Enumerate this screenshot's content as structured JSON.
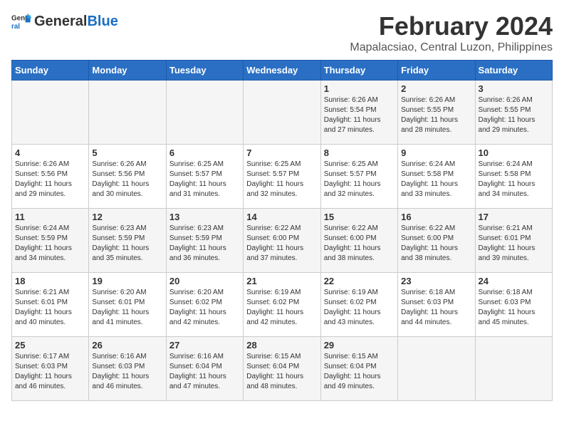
{
  "header": {
    "logo_general": "General",
    "logo_blue": "Blue",
    "title": "February 2024",
    "subtitle": "Mapalacsiao, Central Luzon, Philippines"
  },
  "days_of_week": [
    "Sunday",
    "Monday",
    "Tuesday",
    "Wednesday",
    "Thursday",
    "Friday",
    "Saturday"
  ],
  "weeks": [
    [
      {
        "day": "",
        "content": ""
      },
      {
        "day": "",
        "content": ""
      },
      {
        "day": "",
        "content": ""
      },
      {
        "day": "",
        "content": ""
      },
      {
        "day": "1",
        "content": "Sunrise: 6:26 AM\nSunset: 5:54 PM\nDaylight: 11 hours\nand 27 minutes."
      },
      {
        "day": "2",
        "content": "Sunrise: 6:26 AM\nSunset: 5:55 PM\nDaylight: 11 hours\nand 28 minutes."
      },
      {
        "day": "3",
        "content": "Sunrise: 6:26 AM\nSunset: 5:55 PM\nDaylight: 11 hours\nand 29 minutes."
      }
    ],
    [
      {
        "day": "4",
        "content": "Sunrise: 6:26 AM\nSunset: 5:56 PM\nDaylight: 11 hours\nand 29 minutes."
      },
      {
        "day": "5",
        "content": "Sunrise: 6:26 AM\nSunset: 5:56 PM\nDaylight: 11 hours\nand 30 minutes."
      },
      {
        "day": "6",
        "content": "Sunrise: 6:25 AM\nSunset: 5:57 PM\nDaylight: 11 hours\nand 31 minutes."
      },
      {
        "day": "7",
        "content": "Sunrise: 6:25 AM\nSunset: 5:57 PM\nDaylight: 11 hours\nand 32 minutes."
      },
      {
        "day": "8",
        "content": "Sunrise: 6:25 AM\nSunset: 5:57 PM\nDaylight: 11 hours\nand 32 minutes."
      },
      {
        "day": "9",
        "content": "Sunrise: 6:24 AM\nSunset: 5:58 PM\nDaylight: 11 hours\nand 33 minutes."
      },
      {
        "day": "10",
        "content": "Sunrise: 6:24 AM\nSunset: 5:58 PM\nDaylight: 11 hours\nand 34 minutes."
      }
    ],
    [
      {
        "day": "11",
        "content": "Sunrise: 6:24 AM\nSunset: 5:59 PM\nDaylight: 11 hours\nand 34 minutes."
      },
      {
        "day": "12",
        "content": "Sunrise: 6:23 AM\nSunset: 5:59 PM\nDaylight: 11 hours\nand 35 minutes."
      },
      {
        "day": "13",
        "content": "Sunrise: 6:23 AM\nSunset: 5:59 PM\nDaylight: 11 hours\nand 36 minutes."
      },
      {
        "day": "14",
        "content": "Sunrise: 6:22 AM\nSunset: 6:00 PM\nDaylight: 11 hours\nand 37 minutes."
      },
      {
        "day": "15",
        "content": "Sunrise: 6:22 AM\nSunset: 6:00 PM\nDaylight: 11 hours\nand 38 minutes."
      },
      {
        "day": "16",
        "content": "Sunrise: 6:22 AM\nSunset: 6:00 PM\nDaylight: 11 hours\nand 38 minutes."
      },
      {
        "day": "17",
        "content": "Sunrise: 6:21 AM\nSunset: 6:01 PM\nDaylight: 11 hours\nand 39 minutes."
      }
    ],
    [
      {
        "day": "18",
        "content": "Sunrise: 6:21 AM\nSunset: 6:01 PM\nDaylight: 11 hours\nand 40 minutes."
      },
      {
        "day": "19",
        "content": "Sunrise: 6:20 AM\nSunset: 6:01 PM\nDaylight: 11 hours\nand 41 minutes."
      },
      {
        "day": "20",
        "content": "Sunrise: 6:20 AM\nSunset: 6:02 PM\nDaylight: 11 hours\nand 42 minutes."
      },
      {
        "day": "21",
        "content": "Sunrise: 6:19 AM\nSunset: 6:02 PM\nDaylight: 11 hours\nand 42 minutes."
      },
      {
        "day": "22",
        "content": "Sunrise: 6:19 AM\nSunset: 6:02 PM\nDaylight: 11 hours\nand 43 minutes."
      },
      {
        "day": "23",
        "content": "Sunrise: 6:18 AM\nSunset: 6:03 PM\nDaylight: 11 hours\nand 44 minutes."
      },
      {
        "day": "24",
        "content": "Sunrise: 6:18 AM\nSunset: 6:03 PM\nDaylight: 11 hours\nand 45 minutes."
      }
    ],
    [
      {
        "day": "25",
        "content": "Sunrise: 6:17 AM\nSunset: 6:03 PM\nDaylight: 11 hours\nand 46 minutes."
      },
      {
        "day": "26",
        "content": "Sunrise: 6:16 AM\nSunset: 6:03 PM\nDaylight: 11 hours\nand 46 minutes."
      },
      {
        "day": "27",
        "content": "Sunrise: 6:16 AM\nSunset: 6:04 PM\nDaylight: 11 hours\nand 47 minutes."
      },
      {
        "day": "28",
        "content": "Sunrise: 6:15 AM\nSunset: 6:04 PM\nDaylight: 11 hours\nand 48 minutes."
      },
      {
        "day": "29",
        "content": "Sunrise: 6:15 AM\nSunset: 6:04 PM\nDaylight: 11 hours\nand 49 minutes."
      },
      {
        "day": "",
        "content": ""
      },
      {
        "day": "",
        "content": ""
      }
    ]
  ]
}
